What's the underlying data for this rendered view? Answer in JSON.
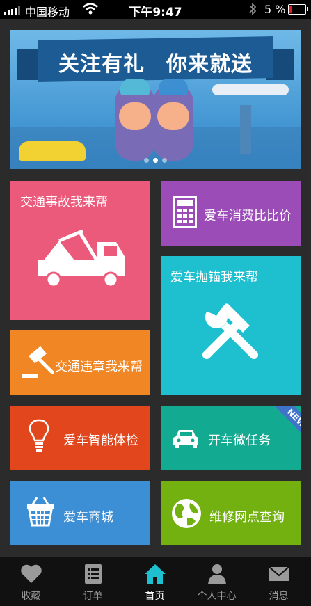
{
  "status_bar": {
    "carrier": "中国移动",
    "time": "下午9:47",
    "battery": "5 %"
  },
  "banner": {
    "headline": "关注有礼　你来就送",
    "slide_index": 1,
    "slide_count": 3
  },
  "tiles": {
    "accident": {
      "label": "交通事故我来帮",
      "color": "#ec5a7b",
      "icon": "tow-truck-icon"
    },
    "cost": {
      "label": "爱车消费比比价",
      "color": "#9b4cb7",
      "icon": "calculator-icon"
    },
    "breakdown": {
      "label": "爱车抛锚我来帮",
      "color": "#1ebfcf",
      "icon": "tools-icon"
    },
    "violation": {
      "label": "交通违章我来帮",
      "color": "#f08624",
      "icon": "gavel-icon"
    },
    "checkup": {
      "label": "爱车智能体检",
      "color": "#e2461c",
      "icon": "lightbulb-icon"
    },
    "task": {
      "label": "开车微任务",
      "color": "#13aa92",
      "icon": "car-icon",
      "badge": "NEW"
    },
    "mall": {
      "label": "爱车商城",
      "color": "#3d8fd5",
      "icon": "basket-icon"
    },
    "repair": {
      "label": "维修网点查询",
      "color": "#72b10f",
      "icon": "globe-icon"
    }
  },
  "tabs": [
    {
      "label": "收藏",
      "icon": "heart-icon"
    },
    {
      "label": "订单",
      "icon": "list-icon"
    },
    {
      "label": "首页",
      "icon": "home-icon",
      "active": true
    },
    {
      "label": "个人中心",
      "icon": "person-icon"
    },
    {
      "label": "消息",
      "icon": "envelope-icon"
    }
  ]
}
